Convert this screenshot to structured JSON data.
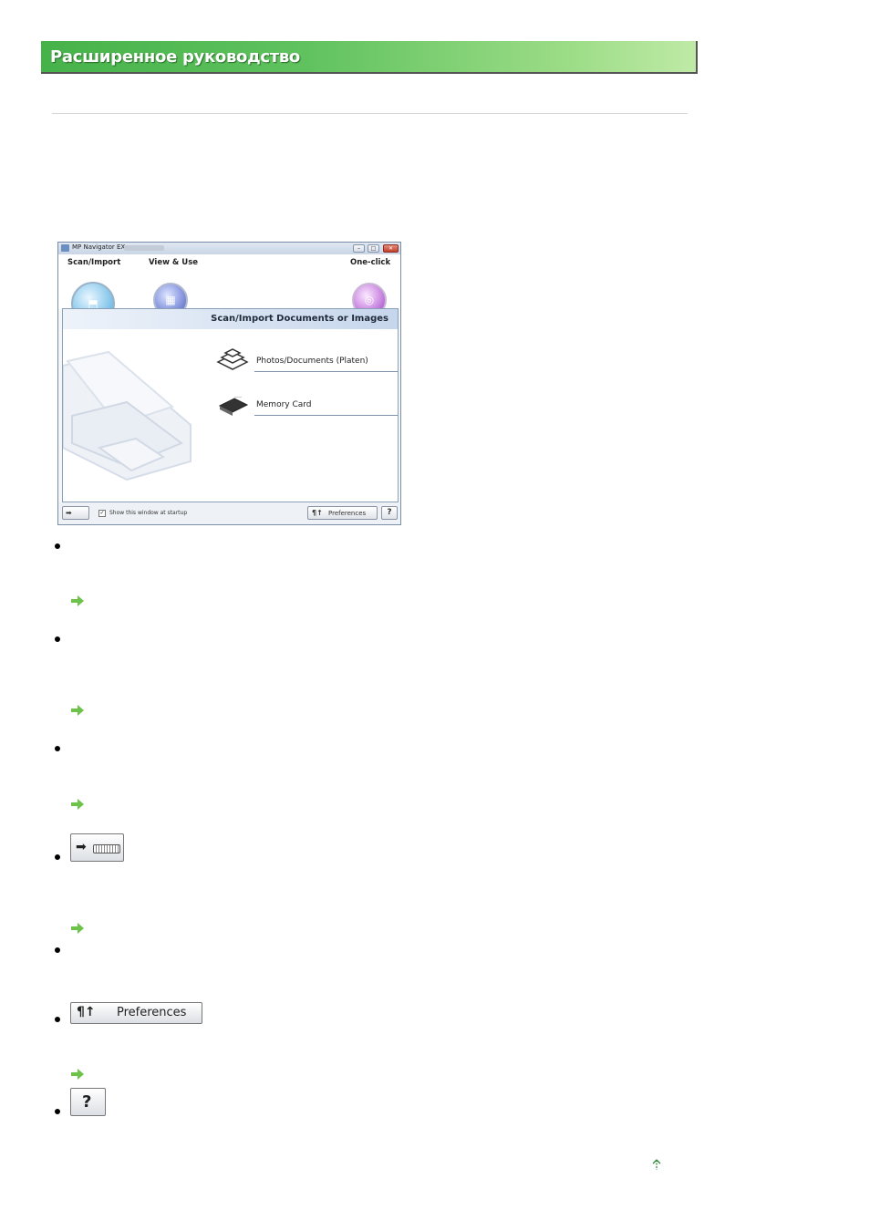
{
  "header": {
    "title": "Расширенное руководство"
  },
  "screenshot": {
    "window_title": "MP Navigator EX",
    "tabs": [
      {
        "label": "Scan/Import",
        "icon": "scanner-icon"
      },
      {
        "label": "View & Use",
        "icon": "grid-icon"
      },
      {
        "label": "One-click",
        "icon": "swirl-icon"
      }
    ],
    "panel_title": "Scan/Import Documents or Images",
    "options": [
      {
        "label": "Photos/Documents (Platen)",
        "icon": "documents-icon"
      },
      {
        "label": "Memory Card",
        "icon": "memory-card-icon"
      }
    ],
    "statusbar": {
      "startup_checkbox_label": "Show this window at startup",
      "startup_checked": true,
      "preferences_label": "Preferences",
      "help_label": "?"
    }
  },
  "buttons": {
    "preferences_label": "Preferences",
    "help_label": "?"
  },
  "colors": {
    "banner_green": "#46b24a",
    "link_arrow_green": "#6cc24a"
  }
}
